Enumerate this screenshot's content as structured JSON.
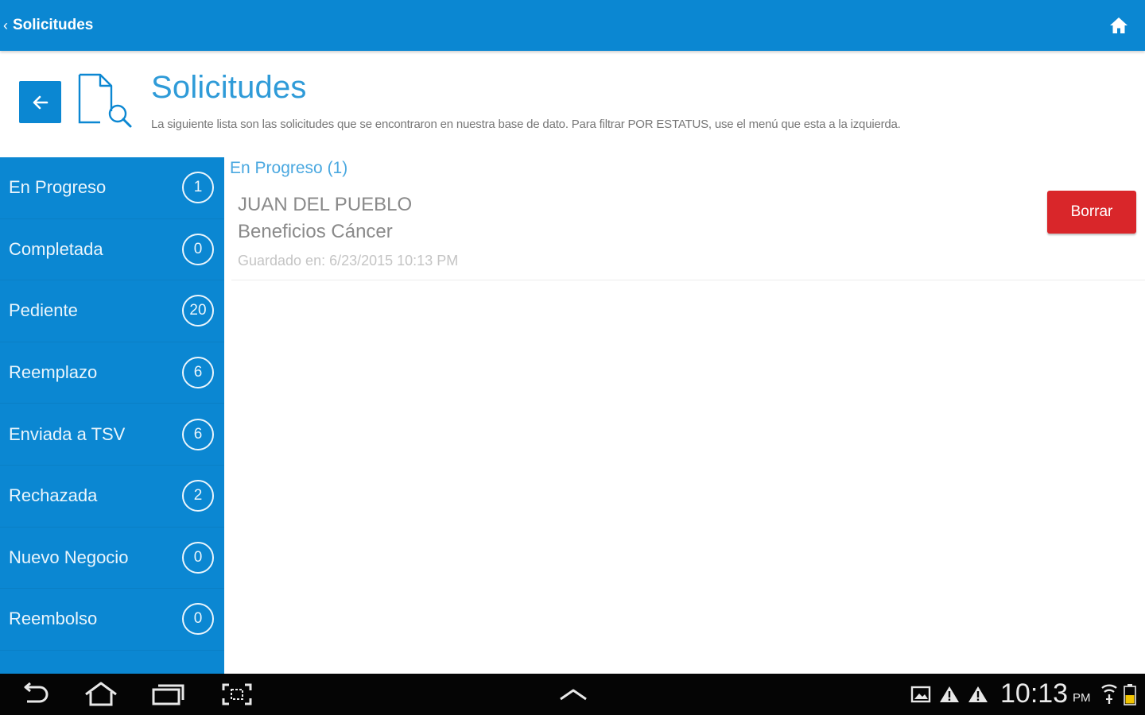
{
  "topbar": {
    "back_label": "Solicitudes",
    "home_icon": "home-icon",
    "color": "#0b87d2"
  },
  "header": {
    "title": "Solicitudes",
    "description": "La siguiente lista son las solicitudes que se encontraron en nuestra base de dato. Para filtrar POR ESTATUS, use el menú que esta a la izquierda.",
    "back_icon": "arrow-left-icon",
    "doc_icon": "document-search-icon"
  },
  "sidebar": {
    "items": [
      {
        "label": "En Progreso",
        "count": "1"
      },
      {
        "label": "Completada",
        "count": "0"
      },
      {
        "label": "Pediente",
        "count": "20"
      },
      {
        "label": "Reemplazo",
        "count": "6"
      },
      {
        "label": "Enviada a TSV",
        "count": "6"
      },
      {
        "label": "Rechazada",
        "count": "2"
      },
      {
        "label": "Nuevo Negocio",
        "count": "0"
      },
      {
        "label": "Reembolso",
        "count": "0"
      }
    ]
  },
  "main": {
    "section_heading": "En Progreso (1)",
    "items": [
      {
        "name": "JUAN DEL PUEBLO",
        "type": "Beneficios Cáncer",
        "saved": "Guardado en: 6/23/2015 10:13 PM",
        "delete_label": "Borrar"
      }
    ]
  },
  "system_bar": {
    "time": "10:13",
    "ampm": "PM",
    "buttons": [
      "back-nav-icon",
      "home-nav-icon",
      "recent-apps-icon",
      "screenshot-icon",
      "chevron-up-icon"
    ],
    "status_icons": [
      "image-notification-icon",
      "warning-icon",
      "warning-icon",
      "wifi-icon",
      "battery-icon"
    ]
  },
  "colors": {
    "accent": "#0b87d2",
    "title": "#2f9bd8",
    "delete": "#d9262a"
  }
}
